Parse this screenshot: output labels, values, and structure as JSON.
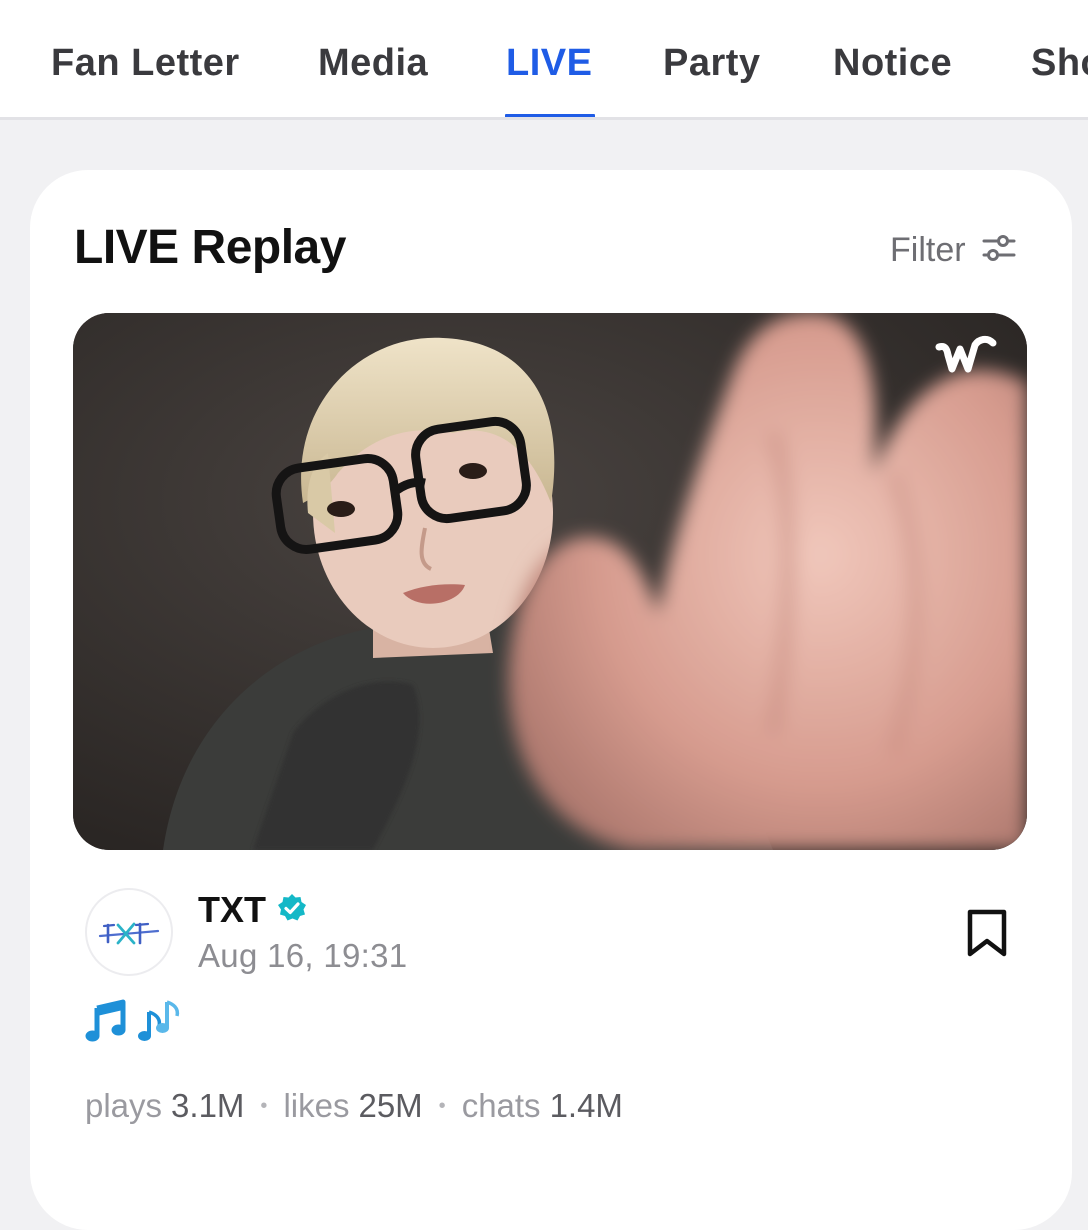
{
  "tabs": [
    {
      "label": "Fan Letter",
      "active": false
    },
    {
      "label": "Media",
      "active": false
    },
    {
      "label": "LIVE",
      "active": true
    },
    {
      "label": "Party",
      "active": false
    },
    {
      "label": "Notice",
      "active": false
    },
    {
      "label": "Sho",
      "active": false
    }
  ],
  "colors": {
    "accent": "#1f5ce6",
    "verified": "#14b8c7",
    "music_note": "#1e90d8"
  },
  "section": {
    "title": "LIVE Replay",
    "filter_label": "Filter",
    "filter_icon": "sliders-icon"
  },
  "video": {
    "thumbnail_icon": "live-replay-thumbnail",
    "watermark_icon": "weverse-w-logo-icon"
  },
  "post": {
    "author": "TXT",
    "verified_icon": "verified-badge-icon",
    "date": "Aug 16, 19:31",
    "text_icons": [
      "musical-note-icon",
      "musical-notes-icon"
    ],
    "bookmark_icon": "bookmark-icon"
  },
  "stats": [
    {
      "label": "plays",
      "value": "3.1M"
    },
    {
      "label": "likes",
      "value": "25M"
    },
    {
      "label": "chats",
      "value": "1.4M"
    }
  ],
  "stat_separator": "•"
}
